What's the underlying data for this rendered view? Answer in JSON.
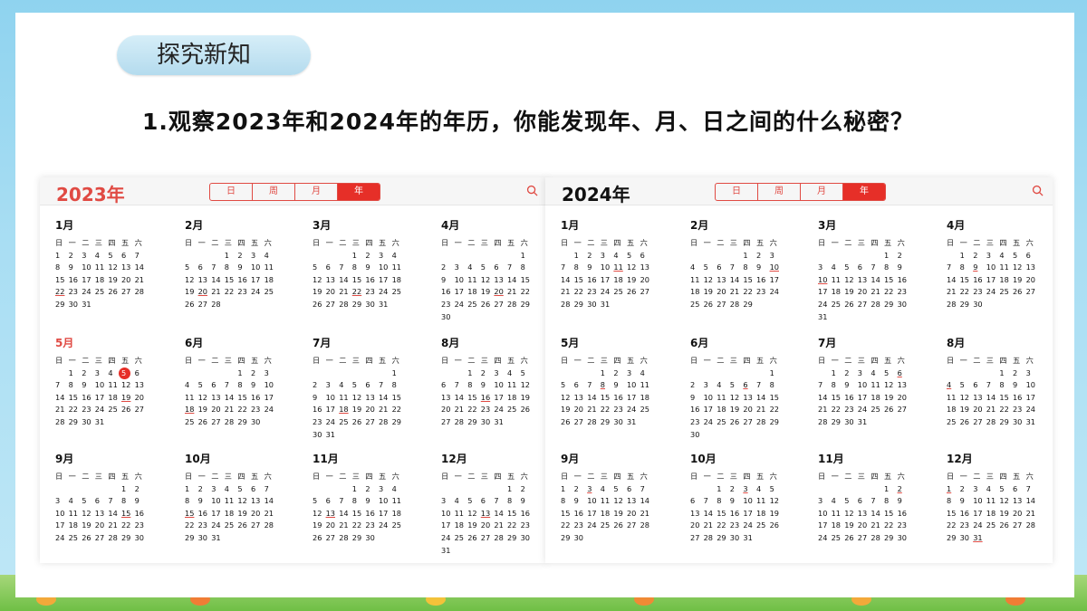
{
  "topic_label": "探究新知",
  "question": "1.观察2023年和2024年的年历，你能发现年、月、日之间的什么秘密？",
  "weekdays": [
    "日",
    "一",
    "二",
    "三",
    "四",
    "五",
    "六"
  ],
  "view_tabs": [
    "日",
    "周",
    "月",
    "年"
  ],
  "active_tab": "年",
  "colors": {
    "accent": "#e62f28",
    "year2023": "#e04a43",
    "year2024": "#111111"
  },
  "calendars": [
    {
      "year_label": "2023年",
      "highlight_month": 5,
      "today": {
        "month": 5,
        "day": 5
      },
      "months": [
        {
          "name": "1月",
          "first_weekday": 0,
          "days": 31,
          "marked": [
            22
          ]
        },
        {
          "name": "2月",
          "first_weekday": 3,
          "days": 28,
          "marked": [
            20
          ]
        },
        {
          "name": "3月",
          "first_weekday": 3,
          "days": 31,
          "marked": [
            22
          ]
        },
        {
          "name": "4月",
          "first_weekday": 6,
          "days": 30,
          "marked": [
            20
          ]
        },
        {
          "name": "5月",
          "first_weekday": 1,
          "days": 31,
          "marked": [
            19
          ]
        },
        {
          "name": "6月",
          "first_weekday": 4,
          "days": 30,
          "marked": [
            18
          ]
        },
        {
          "name": "7月",
          "first_weekday": 6,
          "days": 31,
          "marked": [
            18
          ]
        },
        {
          "name": "8月",
          "first_weekday": 2,
          "days": 31,
          "marked": [
            16
          ]
        },
        {
          "name": "9月",
          "first_weekday": 5,
          "days": 30,
          "marked": [
            15
          ]
        },
        {
          "name": "10月",
          "first_weekday": 0,
          "days": 31,
          "marked": [
            15
          ]
        },
        {
          "name": "11月",
          "first_weekday": 3,
          "days": 30,
          "marked": [
            13
          ]
        },
        {
          "name": "12月",
          "first_weekday": 5,
          "days": 31,
          "marked": [
            13
          ]
        }
      ]
    },
    {
      "year_label": "2024年",
      "highlight_month": 0,
      "today": null,
      "months": [
        {
          "name": "1月",
          "first_weekday": 1,
          "days": 31,
          "marked": [
            11
          ]
        },
        {
          "name": "2月",
          "first_weekday": 4,
          "days": 29,
          "marked": [
            10
          ]
        },
        {
          "name": "3月",
          "first_weekday": 5,
          "days": 31,
          "marked": [
            10
          ]
        },
        {
          "name": "4月",
          "first_weekday": 1,
          "days": 30,
          "marked": [
            9
          ]
        },
        {
          "name": "5月",
          "first_weekday": 3,
          "days": 31,
          "marked": [
            8
          ]
        },
        {
          "name": "6月",
          "first_weekday": 6,
          "days": 30,
          "marked": [
            6
          ]
        },
        {
          "name": "7月",
          "first_weekday": 1,
          "days": 31,
          "marked": [
            6
          ]
        },
        {
          "name": "8月",
          "first_weekday": 4,
          "days": 31,
          "marked": [
            4
          ]
        },
        {
          "name": "9月",
          "first_weekday": 0,
          "days": 30,
          "marked": [
            3
          ]
        },
        {
          "name": "10月",
          "first_weekday": 2,
          "days": 31,
          "marked": [
            3
          ]
        },
        {
          "name": "11月",
          "first_weekday": 5,
          "days": 30,
          "marked": [
            2
          ]
        },
        {
          "name": "12月",
          "first_weekday": 0,
          "days": 31,
          "marked": [
            1,
            31
          ]
        }
      ]
    }
  ]
}
